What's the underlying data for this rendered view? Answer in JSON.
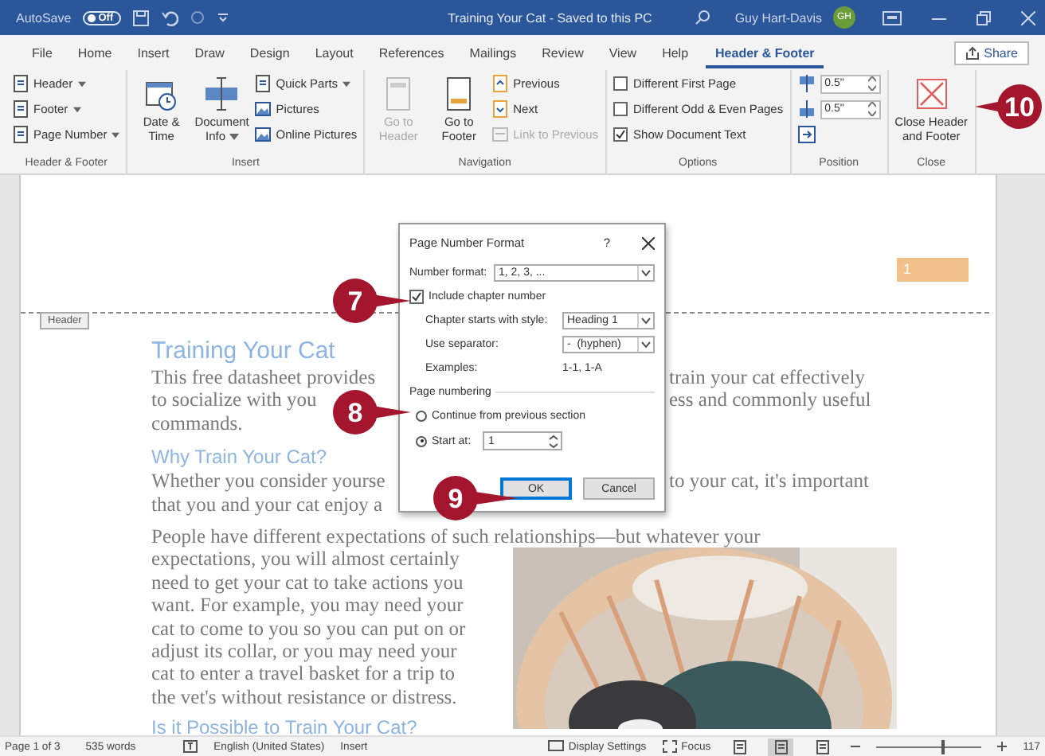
{
  "title_bar": {
    "autosave_label": "AutoSave",
    "autosave_state": "Off",
    "autosave_on": false,
    "title": "Training Your Cat  -  Saved to this PC",
    "user": "Guy Hart-Davis",
    "initials": "GH"
  },
  "tabs": [
    {
      "label": "File",
      "selected": false
    },
    {
      "label": "Home",
      "selected": false
    },
    {
      "label": "Insert",
      "selected": false
    },
    {
      "label": "Draw",
      "selected": false
    },
    {
      "label": "Design",
      "selected": false
    },
    {
      "label": "Layout",
      "selected": false
    },
    {
      "label": "References",
      "selected": false
    },
    {
      "label": "Mailings",
      "selected": false
    },
    {
      "label": "Review",
      "selected": false
    },
    {
      "label": "View",
      "selected": false
    },
    {
      "label": "Help",
      "selected": false
    },
    {
      "label": "Header & Footer",
      "selected": true
    }
  ],
  "share": "Share",
  "ribbon": [
    {
      "label": "Header & Footer",
      "columns": [
        [
          {
            "kind": "small",
            "label": "Header",
            "dropdown": true,
            "disabled": false
          },
          {
            "kind": "small",
            "label": "Footer",
            "dropdown": true,
            "disabled": false
          },
          {
            "kind": "small",
            "label": "Page Number",
            "dropdown": true,
            "disabled": false
          }
        ]
      ]
    },
    {
      "label": "Insert",
      "columns": [
        [
          {
            "kind": "large",
            "label": "Date & Time",
            "dropdown": false,
            "disabled": false
          }
        ],
        [
          {
            "kind": "large",
            "label": "Document Info",
            "dropdown": true,
            "disabled": false
          }
        ],
        [
          {
            "kind": "small",
            "label": "Quick Parts",
            "dropdown": true,
            "disabled": false
          },
          {
            "kind": "small",
            "label": "Pictures",
            "dropdown": false,
            "disabled": false
          },
          {
            "kind": "small",
            "label": "Online Pictures",
            "dropdown": false,
            "disabled": false
          }
        ]
      ]
    },
    {
      "label": "Navigation",
      "columns": [
        [
          {
            "kind": "large",
            "label": "Go to Header",
            "dropdown": false,
            "disabled": true
          }
        ],
        [
          {
            "kind": "large",
            "label": "Go to Footer",
            "dropdown": false,
            "disabled": false
          }
        ],
        [
          {
            "kind": "small",
            "label": "Previous",
            "dropdown": false,
            "disabled": false
          },
          {
            "kind": "small",
            "label": "Next",
            "dropdown": false,
            "disabled": false
          },
          {
            "kind": "small",
            "label": "Link to Previous",
            "dropdown": false,
            "disabled": true
          }
        ]
      ]
    },
    {
      "label": "Options",
      "columns": [
        [
          {
            "kind": "checkbox",
            "label": "Different First Page",
            "checked": false
          },
          {
            "kind": "checkbox",
            "label": "Different Odd & Even Pages",
            "checked": false
          },
          {
            "kind": "checkbox",
            "label": "Show Document Text",
            "checked": true
          }
        ]
      ]
    },
    {
      "label": "Position",
      "columns": [
        [
          {
            "kind": "spin",
            "value": "0.5\""
          },
          {
            "kind": "spin",
            "value": "0.5\""
          },
          {
            "kind": "icon"
          }
        ]
      ]
    },
    {
      "label": "Close",
      "columns": [
        [
          {
            "kind": "large",
            "label": "Close Header and Footer",
            "dropdown": false,
            "disabled": false
          }
        ]
      ]
    }
  ],
  "document": {
    "page_number": "1",
    "header_tag": "Header",
    "blocks": [
      {
        "kind": "title",
        "parts": [
          "Training Your Cat"
        ]
      },
      {
        "kind": "text",
        "parts": [
          "This free datasheet provides",
          "train your cat effectively"
        ]
      },
      {
        "kind": "text",
        "parts": [
          "to socialize with you",
          "ess and commonly useful"
        ]
      },
      {
        "kind": "text",
        "parts": [
          "commands."
        ]
      },
      {
        "kind": "heading",
        "parts": [
          "Why Train Your Cat?"
        ]
      },
      {
        "kind": "text",
        "parts": [
          "Whether you consider yourse",
          "to your cat, it's important"
        ]
      },
      {
        "kind": "text",
        "parts": [
          "that you and your cat enjoy a"
        ]
      },
      {
        "kind": "para",
        "parts": [
          "People have different expectations of such relationships—but whatever your"
        ]
      }
    ],
    "beside_picture": [
      "expectations, you will almost certainly",
      "need to get your cat to take actions you",
      "want. For example, you may need your",
      "cat to come to you so you can put on or",
      "adjust its collar, or you may need your",
      "cat to enter a travel basket for a trip to",
      "the vet's without resistance or distress."
    ],
    "next_heading": "Is it Possible to Train Your Cat?"
  },
  "dialog": {
    "title": "Page Number Format",
    "help": "?",
    "number_format": {
      "label": "Number format:",
      "value": "1, 2, 3, ..."
    },
    "include_chapter": {
      "label": "Include chapter number",
      "checked": true
    },
    "chapter_style": {
      "label": "Chapter starts with style:",
      "value": "Heading 1"
    },
    "separator": {
      "label": "Use separator:",
      "value": "-  (hyphen)"
    },
    "examples": {
      "label": "Examples:",
      "value": "1-1, 1-A"
    },
    "page_numbering": "Page numbering",
    "options": [
      {
        "label": "Continue from previous section",
        "selected": false
      },
      {
        "label": "Start at:",
        "selected": true
      }
    ],
    "start_at": "1",
    "buttons": [
      {
        "label": "OK",
        "default": true
      },
      {
        "label": "Cancel",
        "default": false
      }
    ]
  },
  "callouts": [
    {
      "number": "7"
    },
    {
      "number": "8"
    },
    {
      "number": "9"
    },
    {
      "number": "10"
    }
  ],
  "status_bar": {
    "page": "Page 1 of 3",
    "words": "535 words",
    "language": "English (United States)",
    "mode": "Insert",
    "display_settings": "Display Settings",
    "focus": "Focus",
    "views": [
      {
        "selected": false
      },
      {
        "selected": true
      },
      {
        "selected": false
      }
    ],
    "zoom": {
      "level": 0.62
    },
    "zoom_reading": "117"
  }
}
